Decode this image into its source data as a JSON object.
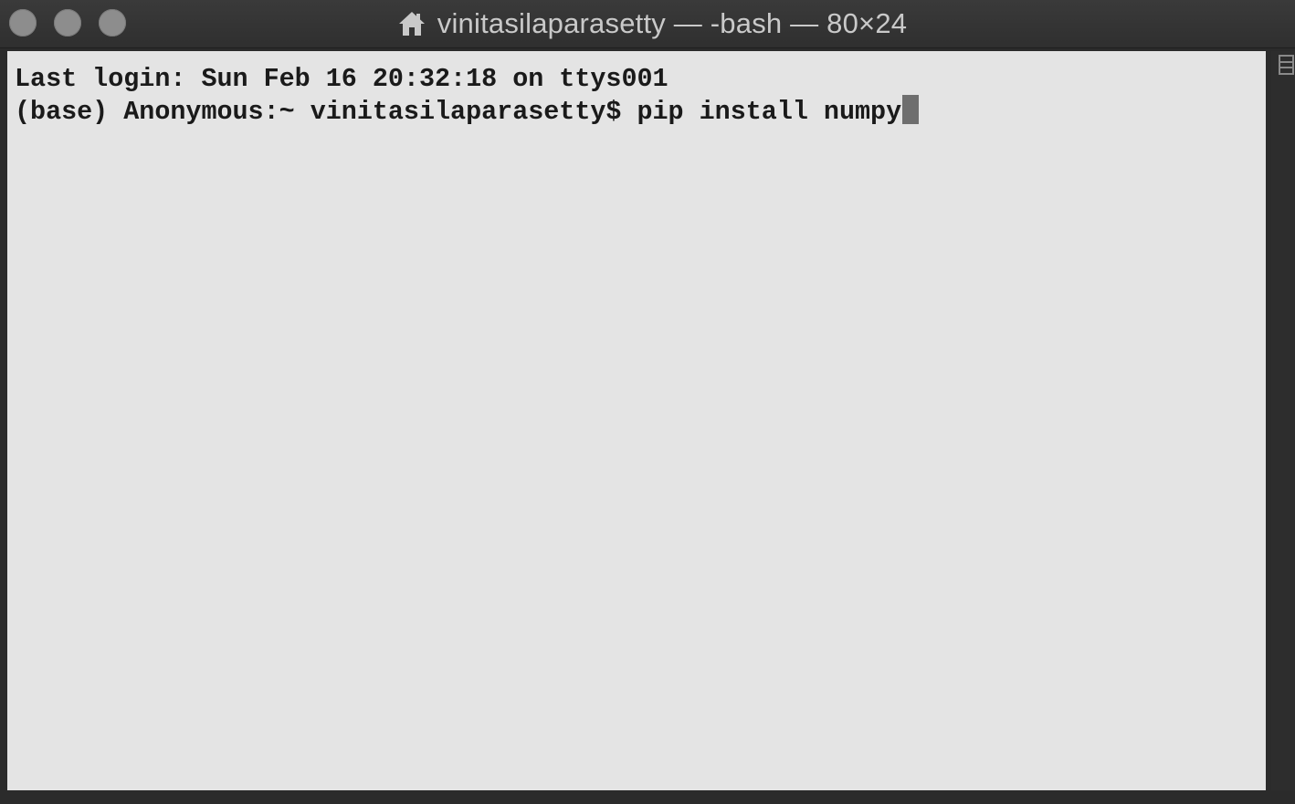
{
  "window": {
    "title": "vinitasilaparasetty — -bash — 80×24",
    "icon": "home-icon"
  },
  "terminal": {
    "lines": [
      "Last login: Sun Feb 16 20:32:18 on ttys001",
      "(base) Anonymous:~ vinitasilaparasetty$ pip install numpy"
    ]
  },
  "colors": {
    "background": "#e4e4e4",
    "text": "#1a1a1a",
    "titlebar": "#333333",
    "cursor": "#6e6e6e"
  }
}
